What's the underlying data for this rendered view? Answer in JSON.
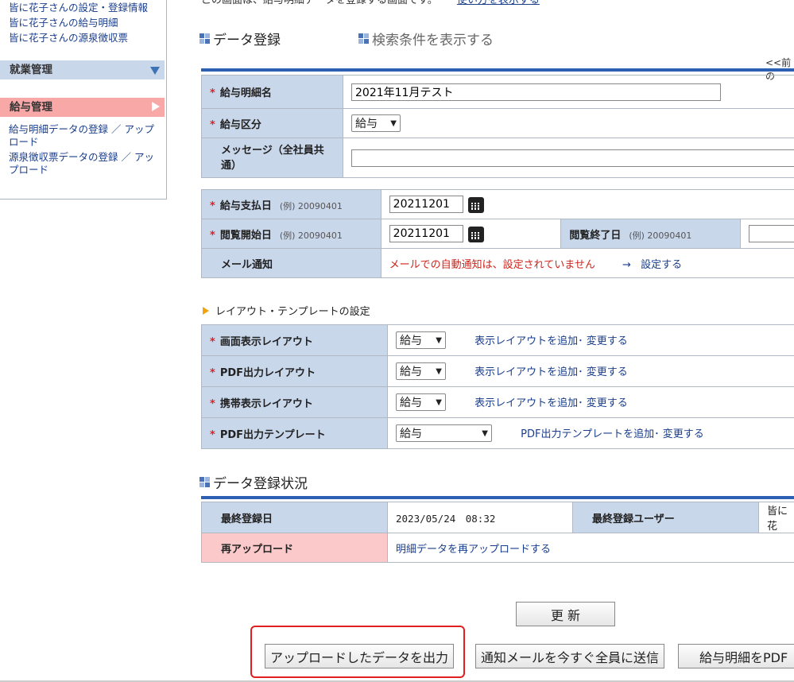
{
  "sidebar": {
    "links_top": [
      "皆に花子さんの設定・登録情報",
      "皆に花子さんの給与明細",
      "皆に花子さんの源泉徴収票"
    ],
    "work_header": "就業管理",
    "pay_header": "給与管理",
    "pay_links": [
      "給与明細データの登録 ／ アップロード",
      "源泉徴収票データの登録 ／ アップロード"
    ]
  },
  "top_text": "この画面は、給与明細データを登録する画面です。",
  "top_link": "使い方を表示する",
  "section_data": "データ登録",
  "section_search": "検索条件を表示する",
  "prev_link": "<<前の",
  "form1": {
    "name_label": "給与明細名",
    "name_value": "2021年11月テスト",
    "kubun_label": "給与区分",
    "kubun_value": "給与",
    "message_label": "メッセージ（全社員共通）",
    "message_value": ""
  },
  "form2": {
    "pay_date_label": "給与支払日",
    "example": "(例) 20090401",
    "pay_date_value": "20211201",
    "view_start_label": "閲覧開始日",
    "view_start_value": "20211201",
    "view_end_label": "閲覧終了日",
    "mail_label": "メール通知",
    "mail_status": "メールでの自動通知は、設定されていません",
    "mail_arrow": "→",
    "mail_link": "設定する"
  },
  "layout_section": "レイアウト・テンプレートの設定",
  "layout": {
    "screen_label": "画面表示レイアウト",
    "pdf_label": "PDF出力レイアウト",
    "mobile_label": "携帯表示レイアウト",
    "template_label": "PDF出力テンプレート",
    "select_value": "給与",
    "add_layout_link": "表示レイアウトを追加･ 変更する",
    "add_template_link": "PDF出力テンプレートを追加･ 変更する"
  },
  "status_section": "データ登録状況",
  "status": {
    "last_date_label": "最終登録日",
    "last_date_value": "2023/05/24　08:32",
    "last_user_label": "最終登録ユーザー",
    "last_user_value": "皆に花",
    "reupload_label": "再アップロード",
    "reupload_link": "明細データを再アップロードする"
  },
  "buttons": {
    "update": "更 新",
    "export": "アップロードしたデータを出力",
    "notify": "通知メールを今すぐ全員に送信",
    "pdf": "給与明細をPDF"
  },
  "colors": {
    "label_bg": "#c9d7eb",
    "pink": "#fbc9c9",
    "required": "#d22",
    "accent": "#2d5fb3",
    "highlight": "#e02020"
  }
}
